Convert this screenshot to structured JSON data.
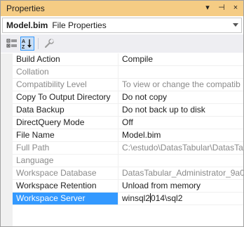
{
  "window": {
    "title": "Properties"
  },
  "title_controls": [
    "▾",
    "⊣",
    "×"
  ],
  "object": {
    "name": "Model.bim",
    "type": "File Properties"
  },
  "rows": [
    {
      "name": "Build Action",
      "value": "Compile",
      "readonly": false
    },
    {
      "name": "Collation",
      "value": "",
      "readonly": true
    },
    {
      "name": "Compatibility Level",
      "value": "To view or change the compatib",
      "readonly": true
    },
    {
      "name": "Copy To Output Directory",
      "value": "Do not copy",
      "readonly": false
    },
    {
      "name": "Data Backup",
      "value": "Do not back up to disk",
      "readonly": false
    },
    {
      "name": "DirectQuery Mode",
      "value": "Off",
      "readonly": false
    },
    {
      "name": "File Name",
      "value": "Model.bim",
      "readonly": false
    },
    {
      "name": "Full Path",
      "value": "C:\\estudo\\DatasTabular\\DatasTab",
      "readonly": true
    },
    {
      "name": "Language",
      "value": "",
      "readonly": true
    },
    {
      "name": "Workspace Database",
      "value": "DatasTabular_Administrator_9a0",
      "readonly": true
    },
    {
      "name": "Workspace Retention",
      "value": "Unload from memory",
      "readonly": false
    },
    {
      "name": "Workspace Server",
      "value_before": "winsql2",
      "value_after": "014\\sql2",
      "readonly": false,
      "selected": true
    }
  ]
}
